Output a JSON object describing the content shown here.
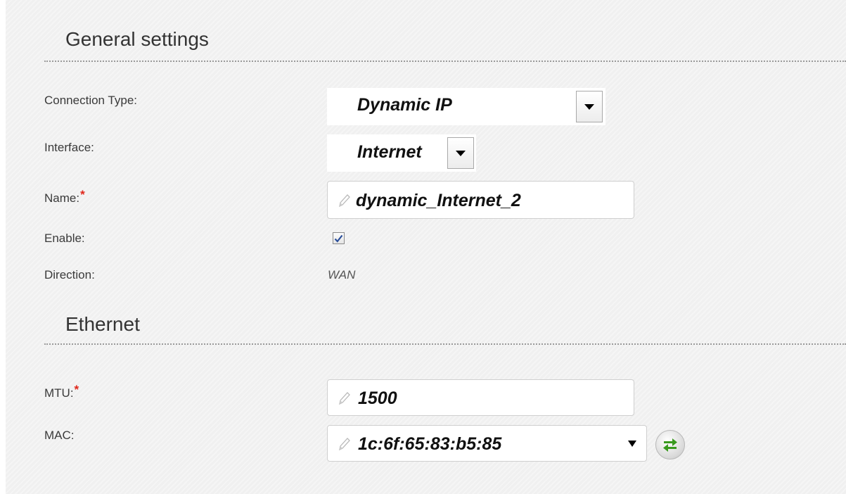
{
  "general": {
    "title": "General settings",
    "connection_type_label": "Connection Type:",
    "connection_type_value": "Dynamic IP",
    "interface_label": "Interface:",
    "interface_value": "Internet",
    "name_label": "Name:",
    "name_value": "dynamic_Internet_2",
    "enable_label": "Enable:",
    "enable_checked": true,
    "direction_label": "Direction:",
    "direction_value": "WAN"
  },
  "ethernet": {
    "title": "Ethernet",
    "mtu_label": "MTU:",
    "mtu_value": "1500",
    "mac_label": "MAC:",
    "mac_value": "1c:6f:65:83:b5:85"
  },
  "required_marker": "*",
  "colors": {
    "required": "#e0261a",
    "refresh_arrows": "#3a9a1f",
    "checkbox_check": "#2a4e9a"
  },
  "icons": [
    "pencil-icon",
    "chevron-down-icon",
    "refresh-icon",
    "checkmark-icon"
  ]
}
